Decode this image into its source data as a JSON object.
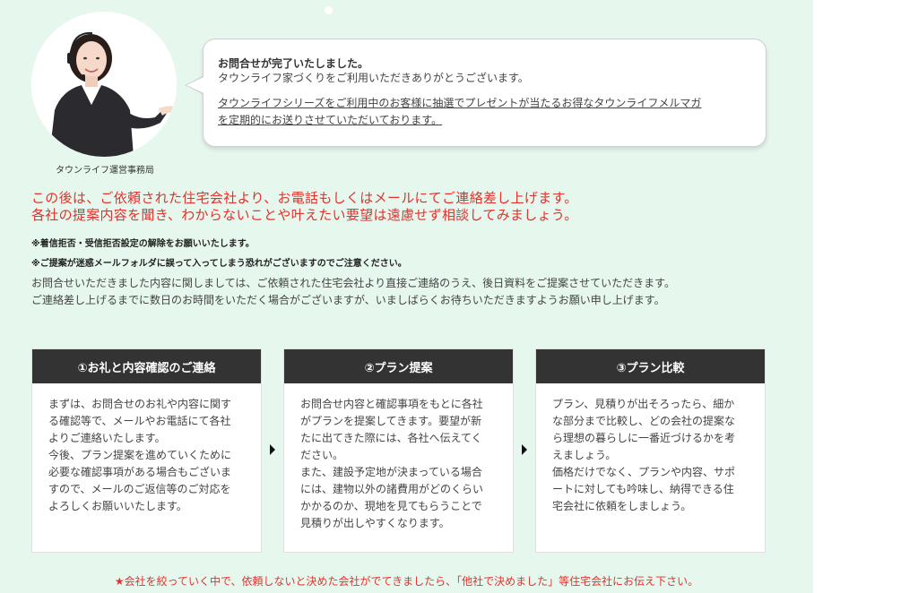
{
  "operator": {
    "caption": "タウンライフ運営事務局",
    "icon": "operator-avatar-image"
  },
  "message": {
    "title": "お問合せが完了いたしました。",
    "thanks": "タウンライフ家づくりをご利用いただきありがとうございます。",
    "link_line1": "タウンライフシリーズをご利用中のお客様に抽選でプレゼントが当たるお得なタウンライフメルマガ",
    "link_line2": "を定期的にお送りさせていただいております。"
  },
  "notice": {
    "red_line1": "この後は、ご依頼された住宅会社より、お電話もしくはメールにてご連絡差し上げます。",
    "red_line2": "各社の提案内容を聞き、わからないことや叶えたい要望は遠慮せず相談してみましょう。",
    "note1": "※着信拒否・受信拒否設定の解除をお願いいたします。",
    "note2": "※ご提案が迷惑メールフォルダに誤って入ってしまう恐れがございますのでご注意ください。",
    "body_line1": "お問合せいただきました内容に関しましては、ご依頼された住宅会社より直接ご連絡のうえ、後日資料をご提案させていただきます。",
    "body_line2": "ご連絡差し上げるまでに数日のお時間をいただく場合がございますが、いましばらくお待ちいただきますようお願い申し上げます。"
  },
  "steps": [
    {
      "title": "①お礼と内容確認のご連絡",
      "lines": [
        "まずは、お問合せのお礼や内容に関す",
        "る確認等で、メールやお電話にて各社",
        "よりご連絡いたします。",
        "今後、プラン提案を進めていくために",
        "必要な確認事項がある場合もございま",
        "すので、メールのご返信等のご対応を",
        "よろしくお願いいたします。"
      ]
    },
    {
      "title": "②プラン提案",
      "lines": [
        "お問合せ内容と確認事項をもとに各社",
        "がプランを提案してきます。要望が新",
        "たに出てきた際には、各社へ伝えてく",
        "ださい。",
        "また、建設予定地が決まっている場合",
        "には、建物以外の諸費用がどのくらい",
        "かかるのか、現地を見てもらうことで",
        "見積りが出しやすくなります。"
      ]
    },
    {
      "title": "③プラン比較",
      "lines": [
        "プラン、見積りが出そろったら、細か",
        "な部分まで比較し、どの会社の提案な",
        "ら理想の暮らしに一番近づけるかを考",
        "えましょう。",
        "価格だけでなく、プランや内容、サポ",
        "ートに対しても吟味し、納得できる住",
        "宅会社に依頼をしましょう。"
      ]
    }
  ],
  "bottom_note": "★会社を絞っていく中で、依頼しないと決めた会社がでてきましたら、「他社で決めました」等住宅会社にお伝え下さい。",
  "colors": {
    "panel_bg": "#e6f8ed",
    "accent_red": "#e3312d",
    "step_header_bg": "#333333"
  }
}
